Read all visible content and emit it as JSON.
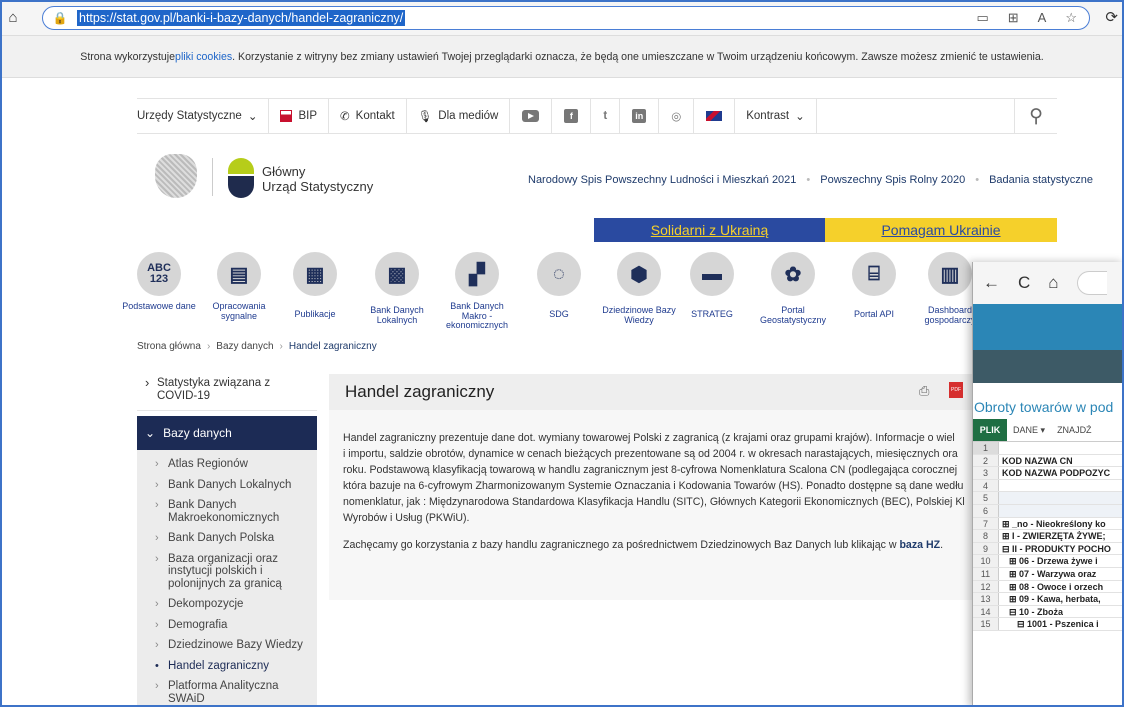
{
  "browser": {
    "url": "https://stat.gov.pl/banki-i-bazy-danych/handel-zagraniczny/",
    "home_icon": "⌂",
    "lock_icon": "🔒",
    "tool_icons": [
      "▭",
      "⊞",
      "A",
      "☆"
    ],
    "ext_icon": "⟳"
  },
  "cookie": {
    "text_before": "Strona wykorzystuje ",
    "link": "pliki cookies",
    "text_after": ". Korzystanie z witryny bez zmiany ustawień Twojej przeglądarki oznacza, że będą one umieszczane w Twoim urządzeniu końcowym. Zawsze możesz zmienić te ustawienia."
  },
  "topnav": {
    "urzedy": "Urzędy Statystyczne",
    "urzedy_chevron": "⌄",
    "bip": "BIP",
    "kontakt_icon": "✆",
    "kontakt": "Kontakt",
    "media_icon": "🎙",
    "media": "Dla mediów",
    "social": [
      "f",
      "t",
      "in",
      "◎"
    ],
    "kontrast": "Kontrast",
    "kontrast_chevron": "⌄",
    "search_icon": "⚲"
  },
  "logo": {
    "line1": "Główny",
    "line2": "Urząd Statystyczny"
  },
  "header_links": [
    "Narodowy Spis Powszechny Ludności i Mieszkań 2021",
    "Powszechny Spis Rolny 2020",
    "Badania statystyczne"
  ],
  "ukraine": {
    "left": "Solidarni z Ukrainą",
    "right": "Pomagam Ukrainie"
  },
  "tiles": [
    {
      "icon_top": "ABC",
      "icon_bottom": "123",
      "label": "Podstawowe dane"
    },
    {
      "icon": "▤",
      "label": "Opracowania sygnalne"
    },
    {
      "icon": "▦",
      "label": "Publikacje"
    },
    {
      "icon": "▩",
      "label": "Bank Danych Lokalnych"
    },
    {
      "icon": "▞",
      "label": "Bank Danych Makro - ekonomicznych"
    },
    {
      "icon": "◌",
      "label": "SDG"
    },
    {
      "icon": "⬢",
      "label": "Dziedzinowe Bazy Wiedzy"
    },
    {
      "icon": "▬",
      "label": "STRATEG"
    },
    {
      "icon": "✿",
      "label": "Portal Geostatystyczny"
    },
    {
      "icon": "⌸",
      "label": "Portal API"
    },
    {
      "icon": "▥",
      "label": "Dashboard gospodarczy"
    }
  ],
  "breadcrumb": [
    "Strona główna",
    "Bazy danych",
    "Handel zagraniczny"
  ],
  "sidebar": {
    "covid": "Statystyka związana z COVID-19",
    "section": "Bazy danych",
    "section_chevron": "⌄",
    "items": [
      "Atlas Regionów",
      "Bank Danych Lokalnych",
      "Bank Danych Makroekonomicznych",
      "Bank Danych Polska",
      "Baza organizacji oraz instytucji polskich i polonijnych za granicą",
      "Dekompozycje",
      "Demografia",
      "Dziedzinowe Bazy Wiedzy",
      "Handel zagraniczny",
      "Platforma Analityczna SWAiD"
    ]
  },
  "main": {
    "title": "Handel zagraniczny",
    "print_icon": "⎙",
    "pdf_icon": "PDF",
    "lines": [
      "Handel zagraniczny prezentuje dane dot. wymiany towarowej Polski z zagranicą (z krajami oraz grupami krajów). Informacje o wiel",
      "i importu, saldzie obrotów, dynamice w cenach bieżących prezentowane są od 2004 r. w okresach narastających, miesięcznych ora",
      "roku. Podstawową klasyfikacją towarową w handlu zagranicznym jest 8-cyfrowa Nomenklatura Scalona CN (podlegająca corocznej",
      "która bazuje na 6-cyfrowym Zharmonizowanym Systemie Oznaczania i Kodowania Towarów (HS). Ponadto dostępne są dane wedłu",
      "nomenklatur, jak : Międzynarodowa Standardowa Klasyfikacja Handlu (SITC), Głównych Kategorii Ekonomicznych (BEC), Polskiej Kl",
      "Wyrobów i Usług (PKWiU)."
    ],
    "para2_text": "Zachęcamy go korzystania z bazy handlu zagranicznego za pośrednictwem Dziedzinowych Baz Danych lub klikając w ",
    "para2_link": "baza HZ",
    "para2_end": "."
  },
  "window2": {
    "nav_icons": [
      "←",
      "C",
      "⌂"
    ],
    "title": "Obroty towarów w pod",
    "menu": {
      "plik": "PLIK",
      "dane": "DANE",
      "dane_chevron": "▾",
      "znajdz": "ZNAJDŹ"
    },
    "rows": [
      {
        "n": "1",
        "text": ""
      },
      {
        "n": "2",
        "text": "KOD NAZWA CN"
      },
      {
        "n": "3",
        "text": "KOD NAZWA PODPOZYC"
      },
      {
        "n": "4",
        "text": ""
      },
      {
        "n": "5",
        "text": ""
      },
      {
        "n": "6",
        "text": ""
      },
      {
        "n": "7",
        "text": "⊞ _no - Nieokreślony ko"
      },
      {
        "n": "8",
        "text": "⊞ I - ZWIERZĘTA ŻYWE;"
      },
      {
        "n": "9",
        "text": "⊟ II - PRODUKTY POCHO"
      },
      {
        "n": "10",
        "text": "⊞ 06 - Drzewa żywe i"
      },
      {
        "n": "11",
        "text": "⊞ 07 - Warzywa oraz"
      },
      {
        "n": "12",
        "text": "⊞ 08 - Owoce i orzech"
      },
      {
        "n": "13",
        "text": "⊞ 09 - Kawa, herbata,"
      },
      {
        "n": "14",
        "text": "⊟ 10 - Zboża"
      },
      {
        "n": "15",
        "text": "⊟ 1001 - Pszenica i"
      }
    ]
  }
}
